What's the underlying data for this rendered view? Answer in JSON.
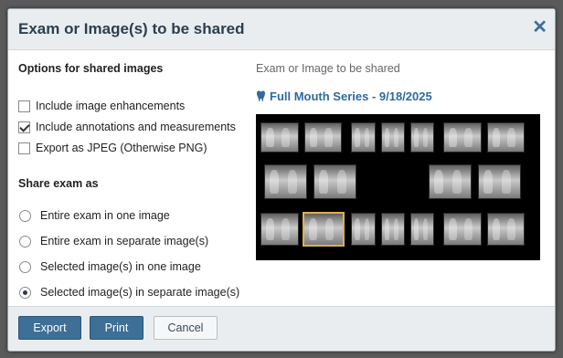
{
  "dialog": {
    "title": "Exam or Image(s) to be shared",
    "close_icon": "close-icon"
  },
  "options": {
    "heading": "Options for shared images",
    "items": [
      {
        "label": "Include image enhancements",
        "checked": false
      },
      {
        "label": "Include annotations and measurements",
        "checked": true
      },
      {
        "label": "Export as JPEG (Otherwise PNG)",
        "checked": false
      }
    ]
  },
  "share": {
    "heading": "Share exam as",
    "items": [
      {
        "label": "Entire exam in one image",
        "selected": false
      },
      {
        "label": "Entire exam in separate image(s)",
        "selected": false
      },
      {
        "label": "Selected image(s) in one image",
        "selected": false
      },
      {
        "label": "Selected image(s) in separate image(s)",
        "selected": true
      }
    ]
  },
  "preview": {
    "subtitle": "Exam or Image to be shared",
    "exam_name": "Full Mouth Series - 9/18/2025",
    "exam_icon": "tooth-icon",
    "selected_image": "bottom-row-2"
  },
  "footer": {
    "export_label": "Export",
    "print_label": "Print",
    "cancel_label": "Cancel"
  },
  "colors": {
    "accent": "#3e6f96",
    "link": "#2f6aa0",
    "selection": "#e0b04a"
  }
}
